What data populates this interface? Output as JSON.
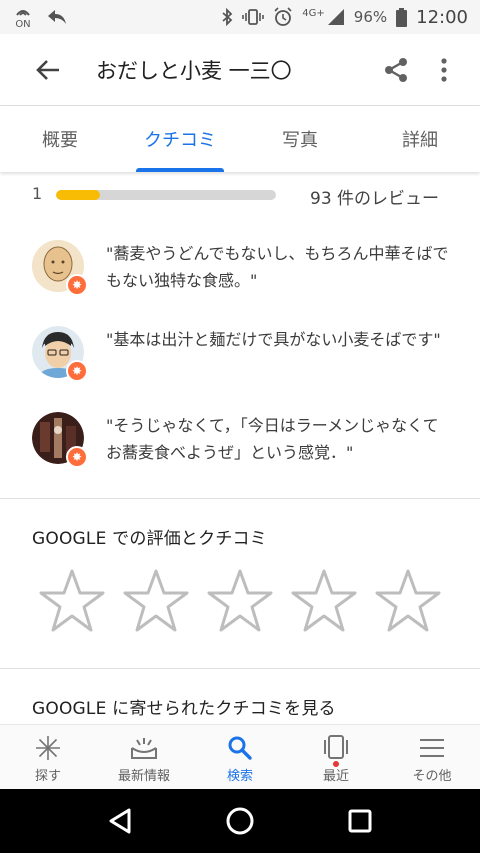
{
  "status_bar": {
    "on_label": "ON",
    "network": "4G+",
    "battery": "96%",
    "time": "12:00"
  },
  "app_bar": {
    "title": "おだしと小麦 一三〇"
  },
  "tabs": [
    {
      "label": "概要",
      "active": false
    },
    {
      "label": "クチコミ",
      "active": true
    },
    {
      "label": "写真",
      "active": false
    },
    {
      "label": "詳細",
      "active": false
    }
  ],
  "rating_summary": {
    "star_level": "1",
    "bar_fill_fraction": 0.2,
    "review_count": "93 件のレビュー"
  },
  "reviews": [
    {
      "text": "\"蕎麦やうどんでもないし、もちろん中華そばでもない独特な食感。\""
    },
    {
      "text": "\"基本は出汁と麺だけで具がない小麦そばです\""
    },
    {
      "text": "\"そうじゃなくて，「今日はラーメンじゃなくてお蕎麦食べようぜ」という感覚．\""
    }
  ],
  "google_rating": {
    "title": "GOOGLE での評価とクチコミ",
    "star_count": 5
  },
  "google_reviews_link": {
    "title": "GOOGLE に寄せられたクチコミを見る"
  },
  "bottom_nav": [
    {
      "label": "探す",
      "icon": "explore-icon",
      "active": false
    },
    {
      "label": "最新情報",
      "icon": "updates-icon",
      "active": false
    },
    {
      "label": "検索",
      "icon": "search-icon",
      "active": true
    },
    {
      "label": "最近",
      "icon": "recent-icon",
      "active": false
    },
    {
      "label": "その他",
      "icon": "menu-icon",
      "active": false
    }
  ],
  "colors": {
    "accent": "#1a73e8",
    "rating_bar": "#f9bc05",
    "badge": "#ff6d3b"
  }
}
